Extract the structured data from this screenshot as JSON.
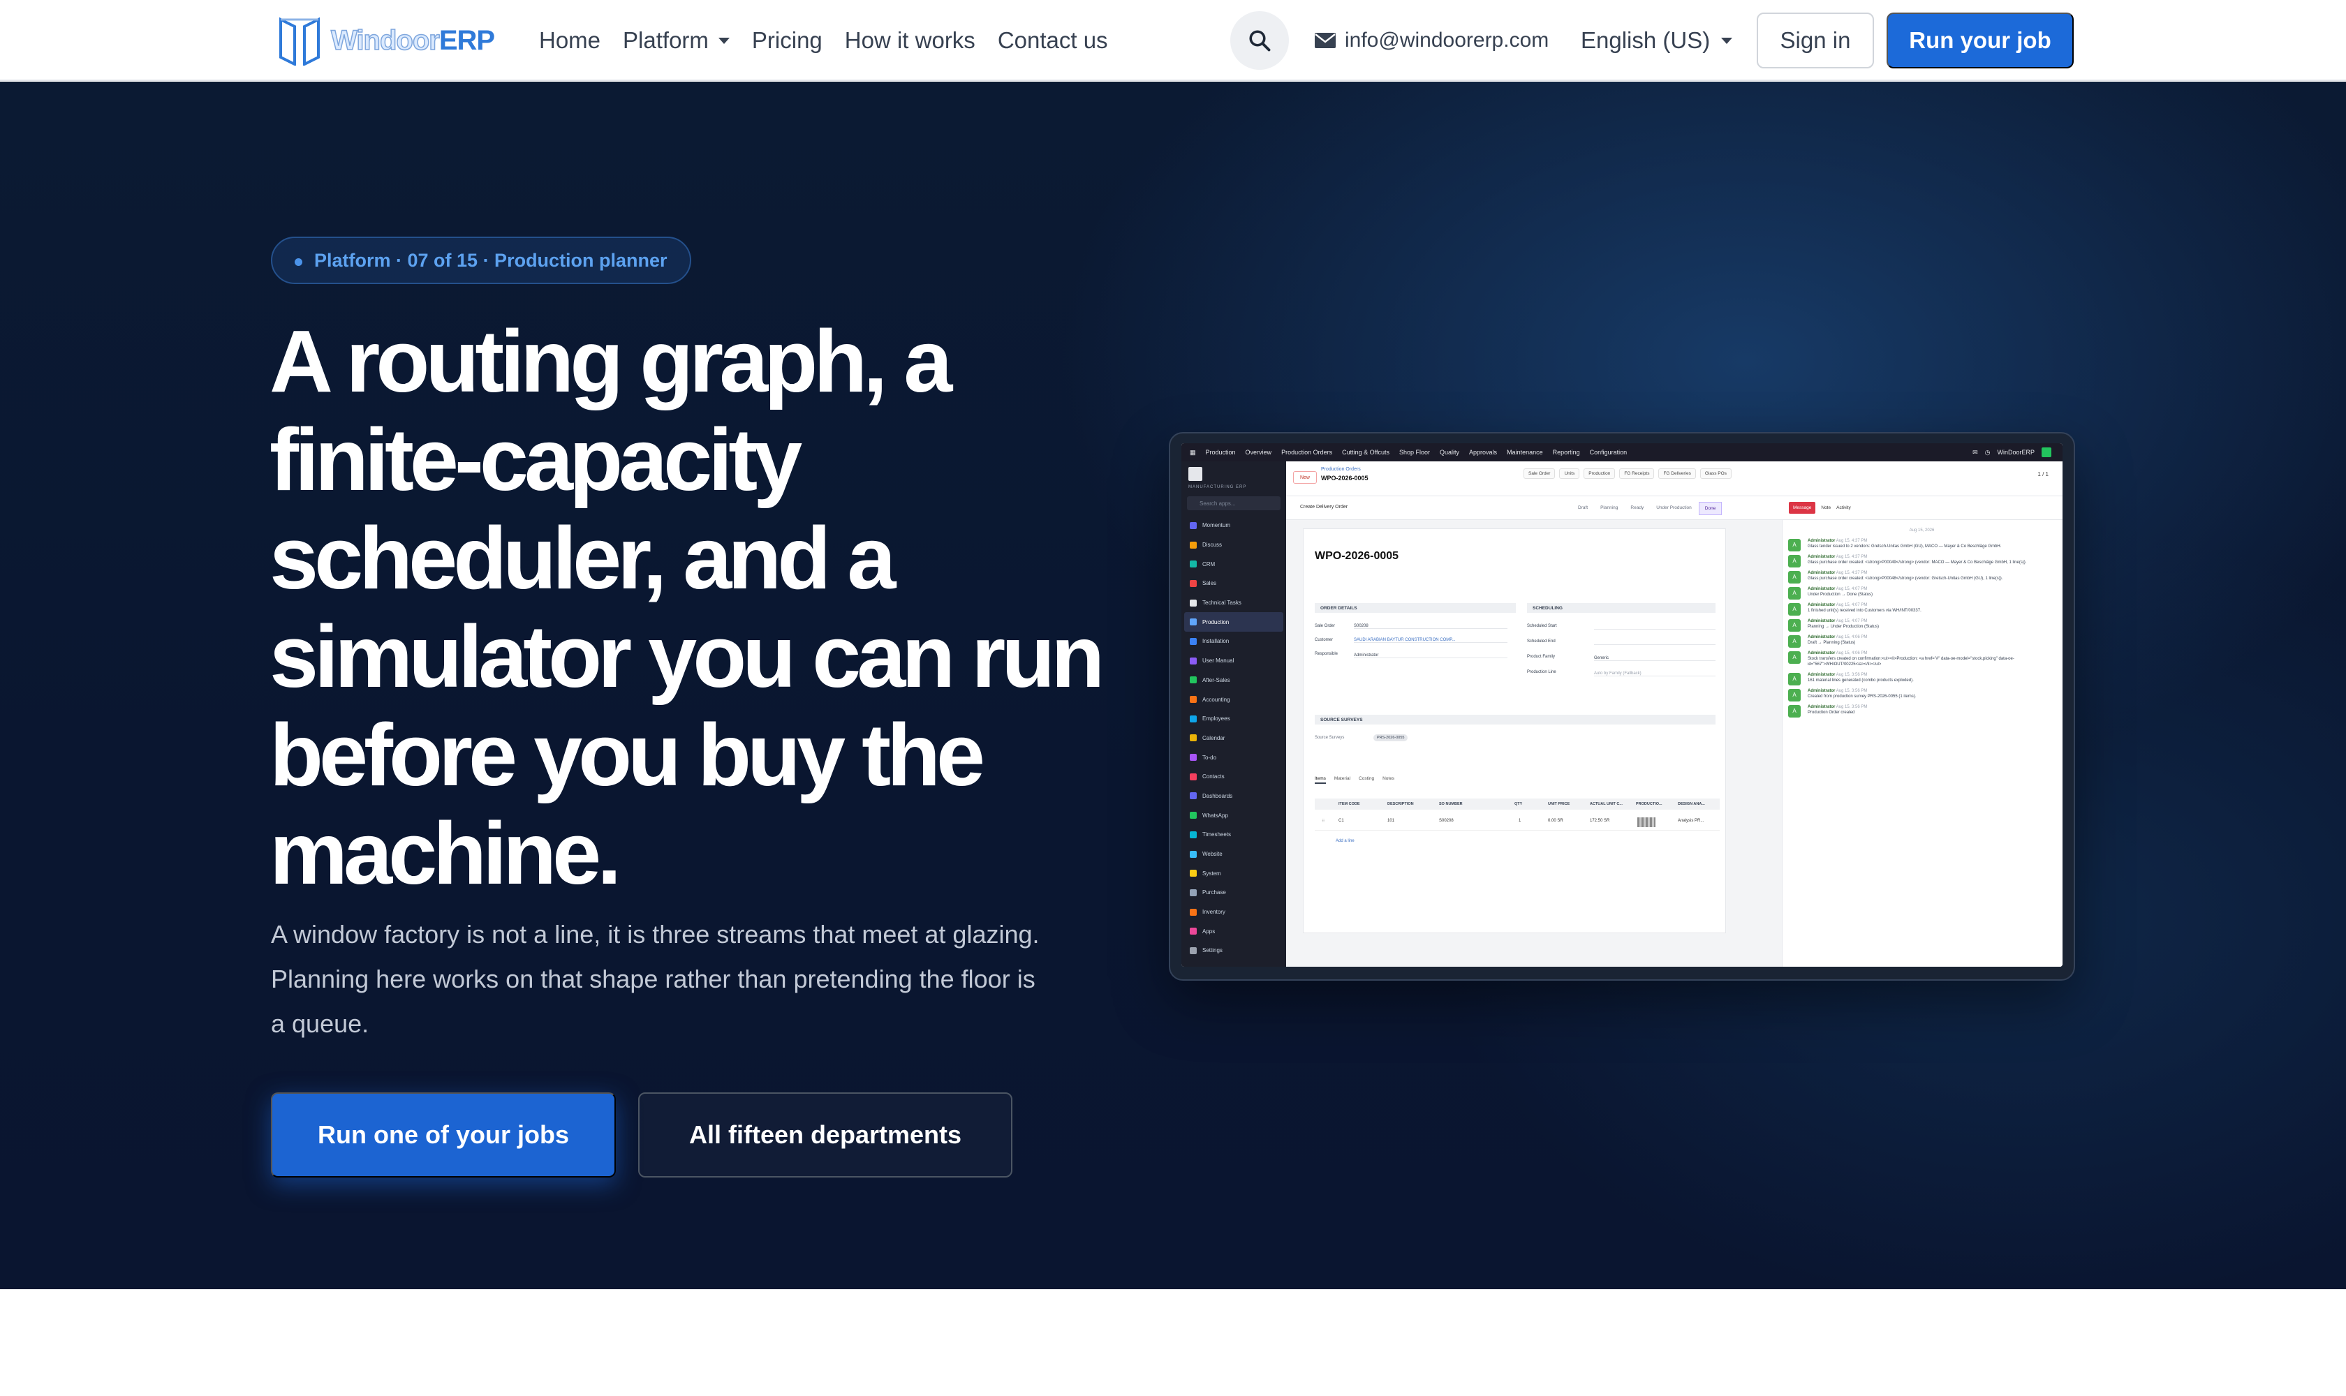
{
  "nav": {
    "logo_light": "Windoor",
    "logo_bold": "ERP",
    "links": [
      {
        "label": "Home"
      },
      {
        "label": "Platform"
      },
      {
        "label": "Pricing"
      },
      {
        "label": "How it works"
      },
      {
        "label": "Contact us"
      }
    ],
    "email": "info@windoorerp.com",
    "language": "English (US)",
    "sign_in": "Sign in",
    "run_job": "Run your job"
  },
  "hero": {
    "pill": "Platform · 07 of 15 · Production planner",
    "headline": "A routing graph, a finite-capacity scheduler, and a simulator you can run before you buy the machine.",
    "lede": "A window factory is not a line, it is three streams that meet at glazing. Planning here works on that shape rather than pretending the floor is a queue.",
    "primary_cta": "Run one of your jobs",
    "secondary_cta": "All fifteen departments"
  },
  "screenshot": {
    "topbar": [
      "Production",
      "Overview",
      "Production Orders",
      "Cutting & Offcuts",
      "Shop Floor",
      "Quality",
      "Approvals",
      "Maintenance",
      "Reporting",
      "Configuration"
    ],
    "company": "WinDoorERP",
    "brand": "MANUFACTURING ERP",
    "search": "Search apps...",
    "apps": [
      {
        "label": "Momentum",
        "color": "#6366f1"
      },
      {
        "label": "Discuss",
        "color": "#f59e0b"
      },
      {
        "label": "CRM",
        "color": "#14b8a6"
      },
      {
        "label": "Sales",
        "color": "#ef4444"
      },
      {
        "label": "Technical Tasks",
        "color": "#e5e7eb"
      },
      {
        "label": "Production",
        "color": "#60a5fa"
      },
      {
        "label": "Installation",
        "color": "#3b82f6"
      },
      {
        "label": "User Manual",
        "color": "#8b5cf6"
      },
      {
        "label": "After-Sales",
        "color": "#22c55e"
      },
      {
        "label": "Accounting",
        "color": "#f97316"
      },
      {
        "label": "Employees",
        "color": "#0ea5e9"
      },
      {
        "label": "Calendar",
        "color": "#eab308"
      },
      {
        "label": "To-do",
        "color": "#a855f7"
      },
      {
        "label": "Contacts",
        "color": "#f43f5e"
      },
      {
        "label": "Dashboards",
        "color": "#6366f1"
      },
      {
        "label": "WhatsApp",
        "color": "#22c55e"
      },
      {
        "label": "Timesheets",
        "color": "#06b6d4"
      },
      {
        "label": "Website",
        "color": "#38bdf8"
      },
      {
        "label": "System",
        "color": "#facc15"
      },
      {
        "label": "Purchase",
        "color": "#94a3b8"
      },
      {
        "label": "Inventory",
        "color": "#f97316"
      },
      {
        "label": "Apps",
        "color": "#ec4899"
      },
      {
        "label": "Settings",
        "color": "#9ca3af"
      }
    ],
    "new_badge": "New",
    "crumb": "Production Orders",
    "record": "WPO-2026-0005",
    "chips": [
      "Sale Order",
      "Units",
      "Production",
      "FG Receipts",
      "FG Deliveries",
      "Glass POs"
    ],
    "pager": "1 / 1",
    "create_delivery": "Create Delivery Order",
    "statuses": [
      "Draft",
      "Planning",
      "Ready",
      "Under Production",
      "Done"
    ],
    "message_btn": "Message",
    "note_btn": "Note",
    "activity_btn": "Activity",
    "order_details": "ORDER DETAILS",
    "scheduling": "SCHEDULING",
    "sale_order_label": "Sale Order",
    "sale_order_val": "S00208",
    "customer_label": "Customer",
    "customer_val": "SAUDI ARABIAN BAYTUR CONSTRUCTION COMP...",
    "responsible_label": "Responsible",
    "responsible_val": "Administrator",
    "sched_start": "Scheduled Start",
    "sched_end": "Scheduled End",
    "product_family": "Product Family",
    "product_family_val": "Generic",
    "production_line": "Production Line",
    "production_line_val": "Auto by Family (Fallback)",
    "source_surveys": "SOURCE SURVEYS",
    "source_surveys_label": "Source Surveys",
    "survey_tag": "PRS-2026-0055",
    "tabs": [
      "Items",
      "Material",
      "Costing",
      "Notes"
    ],
    "cols": [
      "ITEM CODE",
      "DESCRIPTION",
      "SO NUMBER",
      "QTY",
      "UNIT PRICE",
      "ACTUAL UNIT C...",
      "PRODUCTIO...",
      "DESIGN ANA..."
    ],
    "row": [
      "C1",
      "101",
      "S00208",
      "1",
      "0.00 SR",
      "172.50 SR",
      "",
      "Analysis PR..."
    ],
    "add_line": "Add a line",
    "chat_date": "Aug 15, 2026",
    "chat": [
      {
        "who": "Administrator",
        "time": "Aug 15, 4:37 PM",
        "text": "Glass tender issued to 2 vendors: Gretsch-Unitas GmbH (GU), MACO — Mayer & Co Beschläge GmbH."
      },
      {
        "who": "Administrator",
        "time": "Aug 15, 4:37 PM",
        "text": "Glass purchase order created: <strong>P00049</strong> (vendor: MACO — Mayer & Co Beschläge GmbH, 1 line(s))."
      },
      {
        "who": "Administrator",
        "time": "Aug 15, 4:37 PM",
        "text": "Glass purchase order created: <strong>P00048</strong> (vendor: Gretsch-Unitas GmbH (GU), 1 line(s))."
      },
      {
        "who": "Administrator",
        "time": "Aug 15, 4:07 PM",
        "text": "Under Production → Done (Status)"
      },
      {
        "who": "Administrator",
        "time": "Aug 15, 4:07 PM",
        "text": "1 finished unit(s) received into Customers via WH/INT/00337."
      },
      {
        "who": "Administrator",
        "time": "Aug 15, 4:07 PM",
        "text": "Planning → Under Production (Status)"
      },
      {
        "who": "Administrator",
        "time": "Aug 15, 4:06 PM",
        "text": "Draft → Planning (Status)"
      },
      {
        "who": "Administrator",
        "time": "Aug 15, 4:06 PM",
        "text": "Stock transfers created on confirmation:<ul><li>Production: <a href=\"#\" data-oe-model=\"stock.picking\" data-oe-id=\"567\">WH/OUT/00225</a></li></ul>"
      },
      {
        "who": "Administrator",
        "time": "Aug 15, 3:56 PM",
        "text": "161 material lines generated (combo products exploded)."
      },
      {
        "who": "Administrator",
        "time": "Aug 15, 3:56 PM",
        "text": "Created from production survey PRS-2026-0055 (1 items)."
      },
      {
        "who": "Administrator",
        "time": "Aug 15, 3:56 PM",
        "text": "Production Order created"
      }
    ]
  }
}
